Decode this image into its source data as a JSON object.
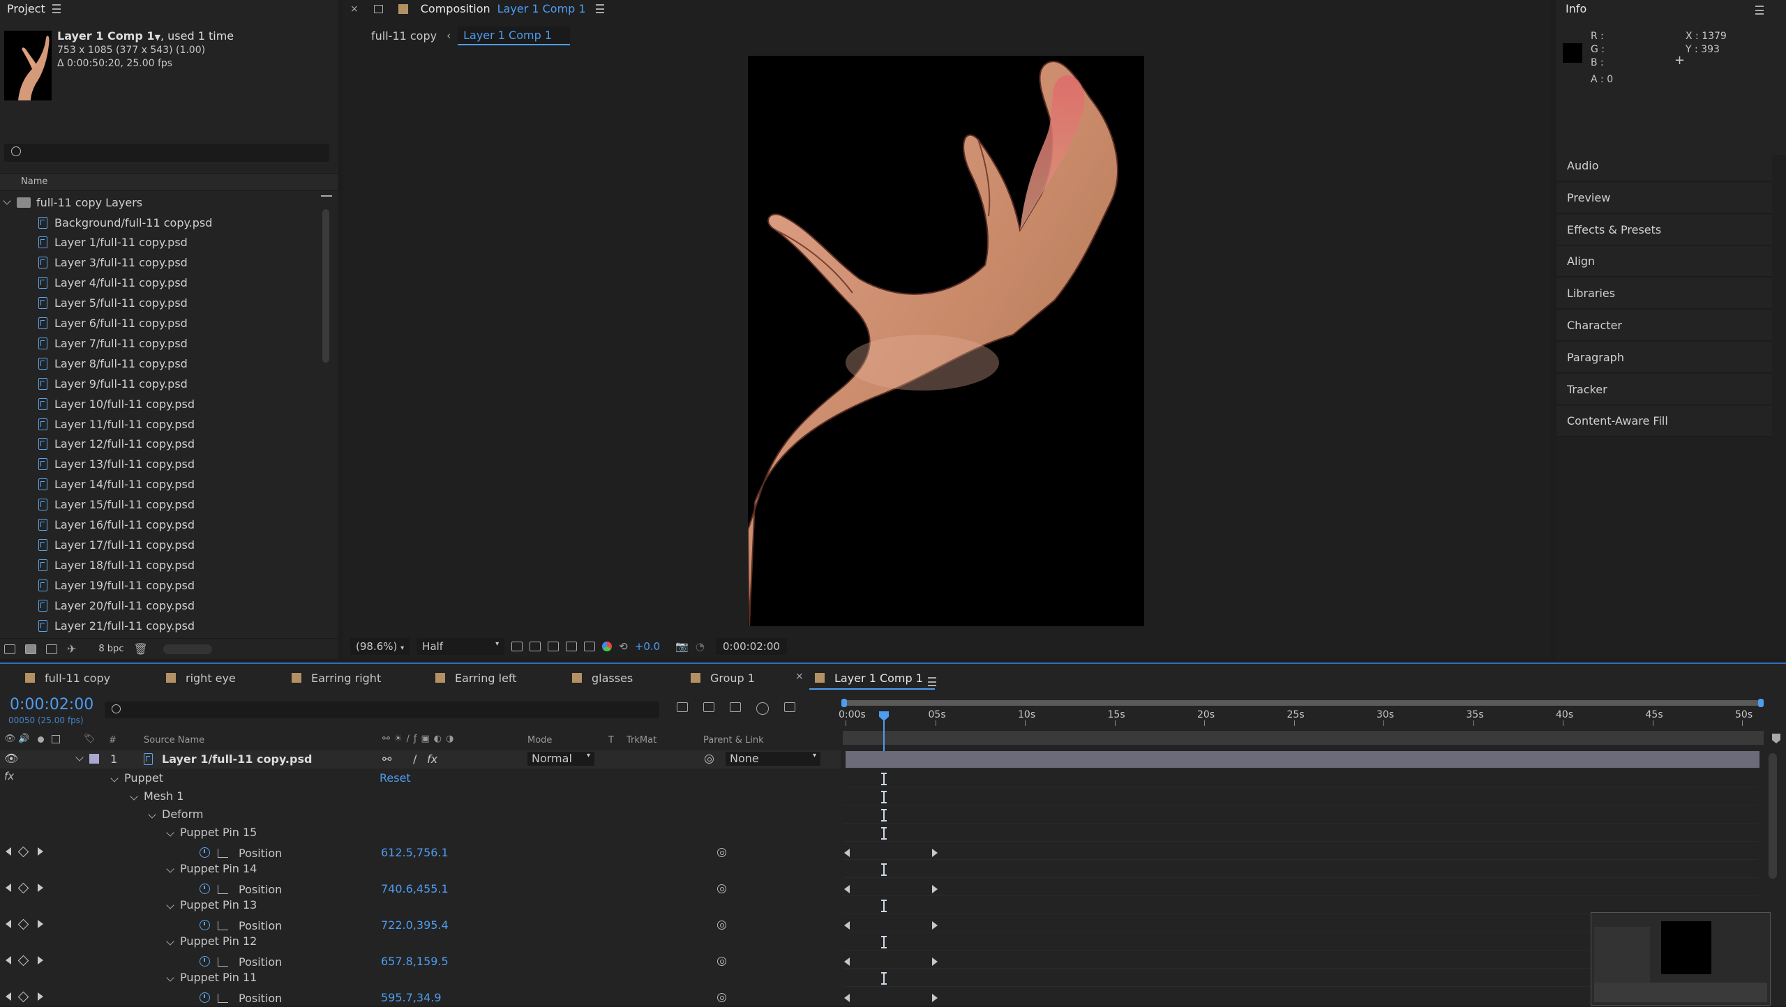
{
  "project": {
    "title": "Project",
    "item_name": "Layer 1 Comp 1",
    "item_usage": ", used 1 time",
    "item_dims": "753 x 1085  (377 x 543) (1.00)",
    "item_duration": "Δ 0:00:50:20, 25.00 fps",
    "search_placeholder": "",
    "col_name": "Name",
    "folder": "full-11 copy Layers",
    "items": [
      "Background/full-11 copy.psd",
      "Layer 1/full-11 copy.psd",
      "Layer 3/full-11 copy.psd",
      "Layer 4/full-11 copy.psd",
      "Layer 5/full-11 copy.psd",
      "Layer 6/full-11 copy.psd",
      "Layer 7/full-11 copy.psd",
      "Layer 8/full-11 copy.psd",
      "Layer 9/full-11 copy.psd",
      "Layer 10/full-11 copy.psd",
      "Layer 11/full-11 copy.psd",
      "Layer 12/full-11 copy.psd",
      "Layer 13/full-11 copy.psd",
      "Layer 14/full-11 copy.psd",
      "Layer 15/full-11 copy.psd",
      "Layer 16/full-11 copy.psd",
      "Layer 17/full-11 copy.psd",
      "Layer 18/full-11 copy.psd",
      "Layer 19/full-11 copy.psd",
      "Layer 20/full-11 copy.psd",
      "Layer 21/full-11 copy.psd"
    ],
    "bpc": "8 bpc"
  },
  "composition": {
    "label": "Composition",
    "name": "Layer 1 Comp 1",
    "crumb_parent": "full-11 copy",
    "crumb_current": "Layer 1 Comp 1",
    "zoom": "(98.6%)",
    "resolution": "Half",
    "exposure": "+0.0",
    "timecode": "0:00:02:00"
  },
  "info": {
    "title": "Info",
    "r": "R :",
    "g": "G :",
    "b": "B :",
    "a": "A :  0",
    "x": "X : 1379",
    "y": "Y : 393"
  },
  "side_panels": [
    "Audio",
    "Preview",
    "Effects & Presets",
    "Align",
    "Libraries",
    "Character",
    "Paragraph",
    "Tracker",
    "Content-Aware Fill"
  ],
  "timeline": {
    "tabs": [
      "full-11 copy",
      "right eye",
      "Earring right",
      "Earring left",
      "glasses",
      "Group 1",
      "Layer 1 Comp 1"
    ],
    "current_time": "0:00:02:00",
    "frame_info": "00050 (25.00 fps)",
    "headers": {
      "num": "#",
      "source": "Source Name",
      "mode": "Mode",
      "t": "T",
      "trkmat": "TrkMat",
      "parent": "Parent & Link"
    },
    "layer": {
      "num": "1",
      "name": "Layer 1/full-11 copy.psd",
      "mode": "Normal",
      "parent": "None"
    },
    "puppet": "Puppet",
    "reset": "Reset",
    "mesh": "Mesh 1",
    "deform": "Deform",
    "pins": [
      {
        "name": "Puppet Pin 15",
        "prop": "Position",
        "value": "612.5,756.1"
      },
      {
        "name": "Puppet Pin 14",
        "prop": "Position",
        "value": "740.6,455.1"
      },
      {
        "name": "Puppet Pin 13",
        "prop": "Position",
        "value": "722.0,395.4"
      },
      {
        "name": "Puppet Pin 12",
        "prop": "Position",
        "value": "657.8,159.5"
      },
      {
        "name": "Puppet Pin 11",
        "prop": "Position",
        "value": "595.7,34.9"
      }
    ],
    "ruler": [
      "0:00s",
      "05s",
      "10s",
      "15s",
      "20s",
      "25s",
      "30s",
      "35s",
      "40s",
      "45s",
      "50s"
    ],
    "fx_label": "fx"
  },
  "colors": {
    "accent": "#4e9cf0",
    "panel": "#232323",
    "bg": "#1d1d1d",
    "layer_bar": "#6b6b7a"
  }
}
